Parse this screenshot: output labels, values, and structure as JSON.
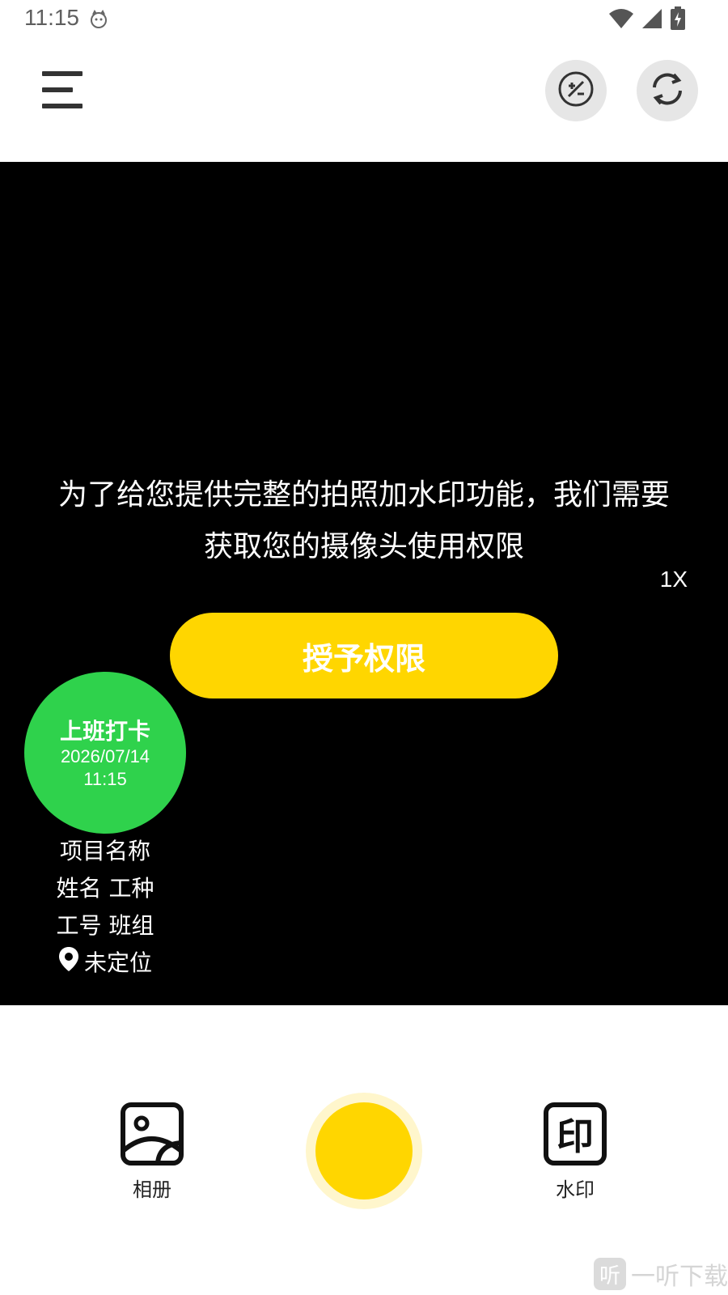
{
  "status": {
    "time": "11:15"
  },
  "toolbar": {
    "menu_icon": "menu-icon",
    "exposure_icon": "exposure-icon",
    "switch_camera_icon": "switch-camera-icon"
  },
  "viewfinder": {
    "permission_message": "为了给您提供完整的拍照加水印功能，我们需要获取您的摄像头使用权限",
    "zoom": "1X",
    "grant_button": "授予权限"
  },
  "watermark_card": {
    "title": "上班打卡",
    "date": "2026/07/14",
    "time": "11:15",
    "project": "项目名称",
    "name_type": "姓名 工种",
    "id_team": "工号 班组",
    "location": "未定位"
  },
  "bottom": {
    "album_label": "相册",
    "watermark_label": "水印",
    "album_icon": "gallery-icon",
    "watermark_icon": "stamp-icon"
  },
  "corner_mark": {
    "badge": "听",
    "text": "一听下载"
  },
  "colors": {
    "accent": "#ffd600",
    "checkin": "#2fd24c",
    "viewfinder": "#000000"
  }
}
